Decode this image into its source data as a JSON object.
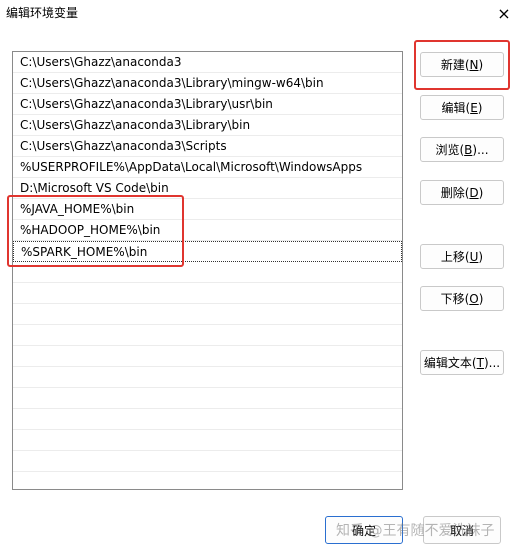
{
  "window": {
    "title": "编辑环境变量",
    "close_label": "×"
  },
  "list": {
    "items": [
      "C:\\Users\\Ghazz\\anaconda3",
      "C:\\Users\\Ghazz\\anaconda3\\Library\\mingw-w64\\bin",
      "C:\\Users\\Ghazz\\anaconda3\\Library\\usr\\bin",
      "C:\\Users\\Ghazz\\anaconda3\\Library\\bin",
      "C:\\Users\\Ghazz\\anaconda3\\Scripts",
      "%USERPROFILE%\\AppData\\Local\\Microsoft\\WindowsApps",
      "D:\\Microsoft VS Code\\bin",
      "%JAVA_HOME%\\bin",
      "%HADOOP_HOME%\\bin",
      "%SPARK_HOME%\\bin"
    ],
    "selected_index": 9
  },
  "buttons": {
    "new": {
      "text": "新建(",
      "key": "N",
      "close": ")"
    },
    "edit": {
      "text": "编辑(",
      "key": "E",
      "close": ")"
    },
    "browse": {
      "text": "浏览(",
      "key": "B",
      "close": ")..."
    },
    "delete": {
      "text": "删除(",
      "key": "D",
      "close": ")"
    },
    "move_up": {
      "text": "上移(",
      "key": "U",
      "close": ")"
    },
    "move_down": {
      "text": "下移(",
      "key": "O",
      "close": ")"
    },
    "edit_text": {
      "text": "编辑文本(",
      "key": "T",
      "close": ")..."
    },
    "ok": "确定",
    "cancel": "取消"
  },
  "watermark": "知乎 @王有随不爱洗袜子",
  "colors": {
    "highlight": "#e0352f",
    "primary_border": "#2a6fd0"
  }
}
